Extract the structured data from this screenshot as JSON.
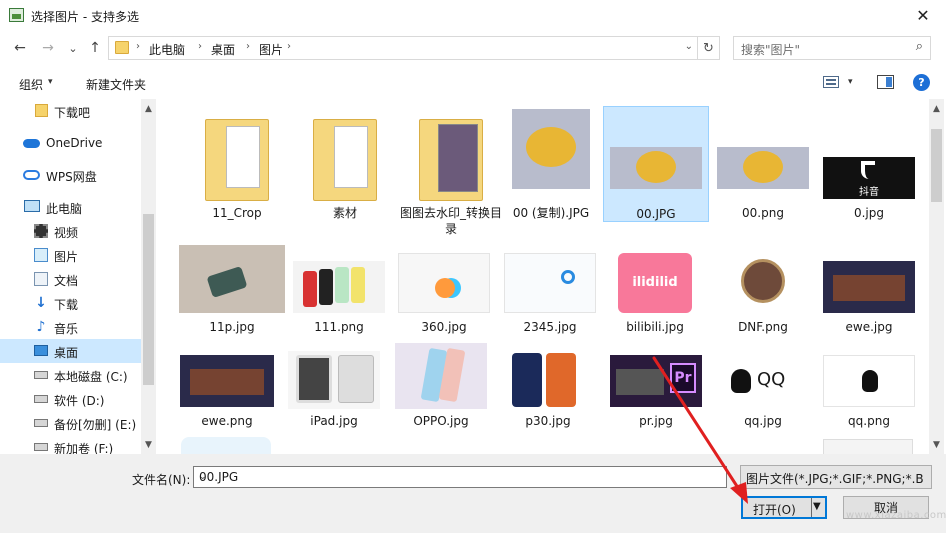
{
  "window": {
    "title": "选择图片 - 支持多选",
    "close_glyph": "✕"
  },
  "nav": {
    "back": "←",
    "forward": "→",
    "recent": "⌄",
    "up": "↑"
  },
  "address": {
    "crumbs": [
      "此电脑",
      "桌面",
      "图片"
    ],
    "separator": "›",
    "dropdown": "⌄",
    "refresh": "↻"
  },
  "search": {
    "placeholder": "搜索\"图片\"",
    "icon": "⌕"
  },
  "toolbar": {
    "organize": "组织",
    "organize_caret": "▾",
    "new_folder": "新建文件夹",
    "view_caret": "▾",
    "help": "?"
  },
  "sidebar": {
    "items": [
      {
        "label": "下载吧",
        "icon": "folder-icon"
      },
      {
        "label": "OneDrive",
        "icon": "cloud-icon"
      },
      {
        "label": "WPS网盘",
        "icon": "wps-cloud-icon"
      },
      {
        "label": "此电脑",
        "icon": "computer-icon"
      },
      {
        "label": "视频",
        "icon": "video-icon"
      },
      {
        "label": "图片",
        "icon": "pictures-icon"
      },
      {
        "label": "文档",
        "icon": "document-icon"
      },
      {
        "label": "下载",
        "icon": "download-icon"
      },
      {
        "label": "音乐",
        "icon": "music-icon"
      },
      {
        "label": "桌面",
        "icon": "desktop-icon",
        "selected": true
      },
      {
        "label": "本地磁盘 (C:)",
        "icon": "drive-icon"
      },
      {
        "label": "软件 (D:)",
        "icon": "drive-icon"
      },
      {
        "label": "备份[勿删] (E:)",
        "icon": "drive-icon"
      },
      {
        "label": "新加卷 (F:)",
        "icon": "drive-icon"
      }
    ]
  },
  "files": [
    {
      "name": "11_Crop",
      "kind": "folder"
    },
    {
      "name": "素材",
      "kind": "folder"
    },
    {
      "name": "图图去水印_转换目录",
      "kind": "folder"
    },
    {
      "name": "00 (复制).JPG",
      "kind": "image"
    },
    {
      "name": "00.JPG",
      "kind": "image",
      "selected": true
    },
    {
      "name": "00.png",
      "kind": "image"
    },
    {
      "name": "0.jpg",
      "kind": "image",
      "caption": "抖音"
    },
    {
      "name": "11p.jpg",
      "kind": "image"
    },
    {
      "name": "111.png",
      "kind": "image"
    },
    {
      "name": "360.jpg",
      "kind": "image"
    },
    {
      "name": "2345.jpg",
      "kind": "image"
    },
    {
      "name": "bilibili.jpg",
      "kind": "image",
      "caption": "ilidilid"
    },
    {
      "name": "DNF.png",
      "kind": "image"
    },
    {
      "name": "ewe.jpg",
      "kind": "image"
    },
    {
      "name": "ewe.png",
      "kind": "image"
    },
    {
      "name": "iPad.jpg",
      "kind": "image"
    },
    {
      "name": "OPPO.jpg",
      "kind": "image"
    },
    {
      "name": "p30.jpg",
      "kind": "image"
    },
    {
      "name": "pr.jpg",
      "kind": "image",
      "caption": "Pr"
    },
    {
      "name": "qq.jpg",
      "kind": "image",
      "caption": "QQ"
    },
    {
      "name": "qq.png",
      "kind": "image"
    }
  ],
  "scroll": {
    "up": "▲",
    "down": "▼"
  },
  "bottom": {
    "filename_label": "文件名(N):",
    "filename_value": "00.JPG",
    "filetype": "图片文件(*.JPG;*.GIF;*.PNG;*.B",
    "dropdown": "⌄",
    "open_label": "打开(O)",
    "open_arrow": "▼",
    "cancel_label": "取消",
    "watermark": "www.xiazaiba.com"
  },
  "colors": {
    "selection": "#cce8ff",
    "accent": "#0078d7",
    "annotation_arrow": "#e02020"
  }
}
